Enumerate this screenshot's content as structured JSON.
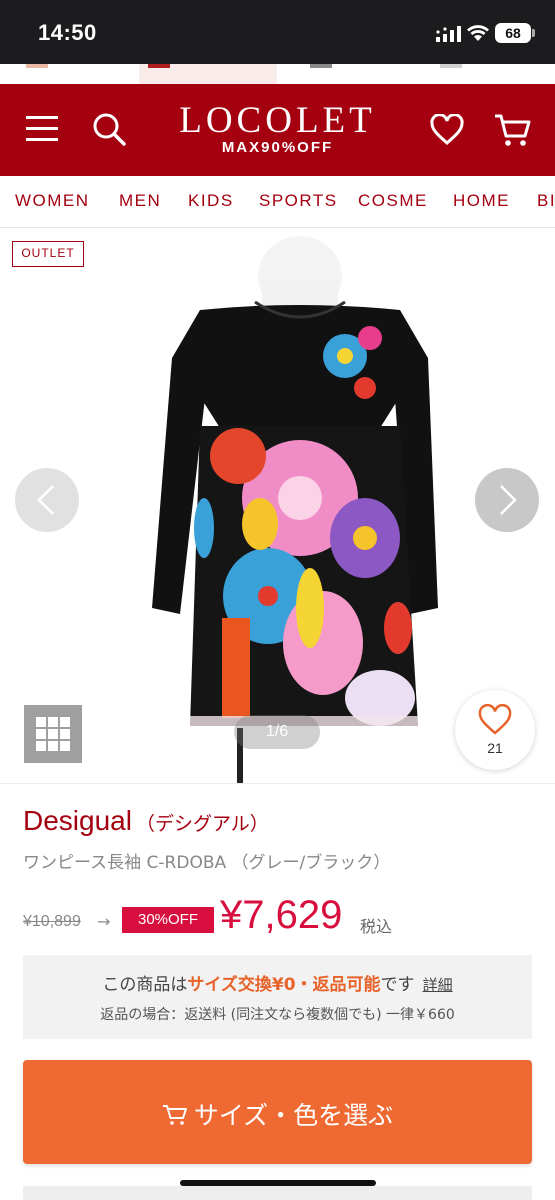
{
  "status_bar": {
    "time": "14:50",
    "battery": "68"
  },
  "header": {
    "logo_name": "LOCOLET",
    "logo_sub": "MAX90%OFF",
    "brand_color": "#a4000f",
    "icons": [
      "menu-icon",
      "search-icon",
      "heart-icon",
      "cart-icon"
    ]
  },
  "categories": [
    "WOMEN",
    "MEN",
    "KIDS",
    "SPORTS",
    "COSME",
    "HOME",
    "BI"
  ],
  "gallery": {
    "badge": "OUTLET",
    "page_indicator": "1/6",
    "favorite_count": "21"
  },
  "product": {
    "brand_en": "Desigual",
    "brand_jp": "（デシグアル）",
    "name": "ワンピース長袖 C-RDOBA （グレー/ブラック）",
    "original_price": "¥10,899",
    "arrow": "→",
    "discount": "30%OFF",
    "sale_price": "¥7,629",
    "tax": "税込",
    "sale_color": "#d80f3e"
  },
  "notice": {
    "prefix": "この商品は",
    "highlight": "サイズ交換¥0・返品可能",
    "suffix": "です",
    "detail_link": "詳細",
    "line2": "返品の場合：返送料 (同注文なら複数個でも) 一律￥660"
  },
  "cta": {
    "label": "サイズ・色を選ぶ",
    "color": "#ef6a33"
  }
}
